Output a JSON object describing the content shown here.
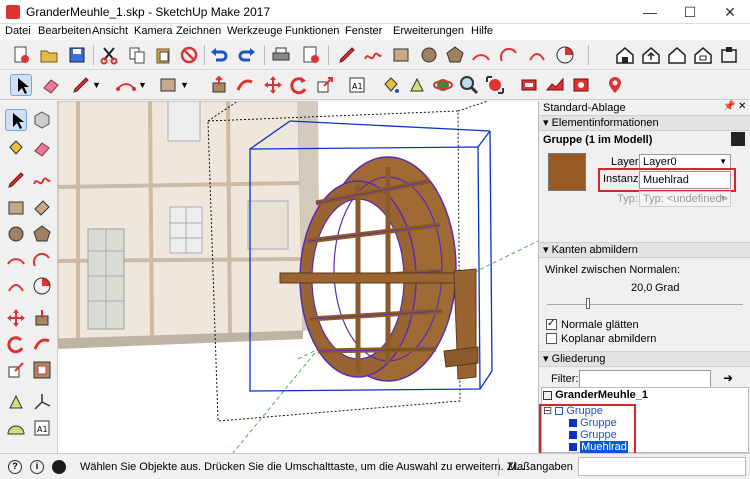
{
  "window": {
    "title": "GranderMeuhle_1.skp - SketchUp Make 2017",
    "minimize": "—",
    "maximize": "☐",
    "close": "✕"
  },
  "menu": [
    "Datei",
    "Bearbeiten",
    "Ansicht",
    "Kamera",
    "Zeichnen",
    "Werkzeuge",
    "Funktionen",
    "Fenster",
    "Erweiterungen",
    "Hilfe"
  ],
  "panel": {
    "tray_title": "Standard-Ablage",
    "pin": "📌",
    "close": "✕",
    "entity_info": {
      "header": "Elementinformationen",
      "entity_name": "Gruppe (1 im Modell)",
      "layer_label": "Layer:",
      "layer_value": "Layer0",
      "instance_label": "Instanz:",
      "instance_value": "Muehlrad",
      "type_label": "Typ:",
      "type_value": "Typ: <undefined>"
    },
    "soften": {
      "header": "Kanten abmildern",
      "angle_label": "Winkel zwischen Normalen:",
      "angle_value": "20,0",
      "angle_unit": "Grad",
      "slider_fraction": 0.2,
      "smooth_label": "Normale glätten",
      "smooth_checked": true,
      "coplanar_label": "Koplanar abmildern",
      "coplanar_checked": false
    },
    "outliner": {
      "header": "Gliederung",
      "filter_label": "Filter:",
      "filter_value": "",
      "root": "GranderMeuhle_1",
      "items": [
        {
          "label": "Gruppe",
          "level": 1,
          "expanded": true
        },
        {
          "label": "Gruppe",
          "level": 2
        },
        {
          "label": "Gruppe",
          "level": 2
        },
        {
          "label": "Muehlrad",
          "level": 2,
          "selected": true
        }
      ]
    }
  },
  "status": {
    "message": "Wählen Sie Objekte aus. Drücken Sie die Umschalttaste, um die Auswahl zu erweitern. Zi...",
    "measure_label": "Maßangaben"
  },
  "colors": {
    "highlight": "#d7262b",
    "selection": "#0a32c8",
    "wood": "#8b5a2b",
    "accent_blue": "#1a55c4"
  }
}
